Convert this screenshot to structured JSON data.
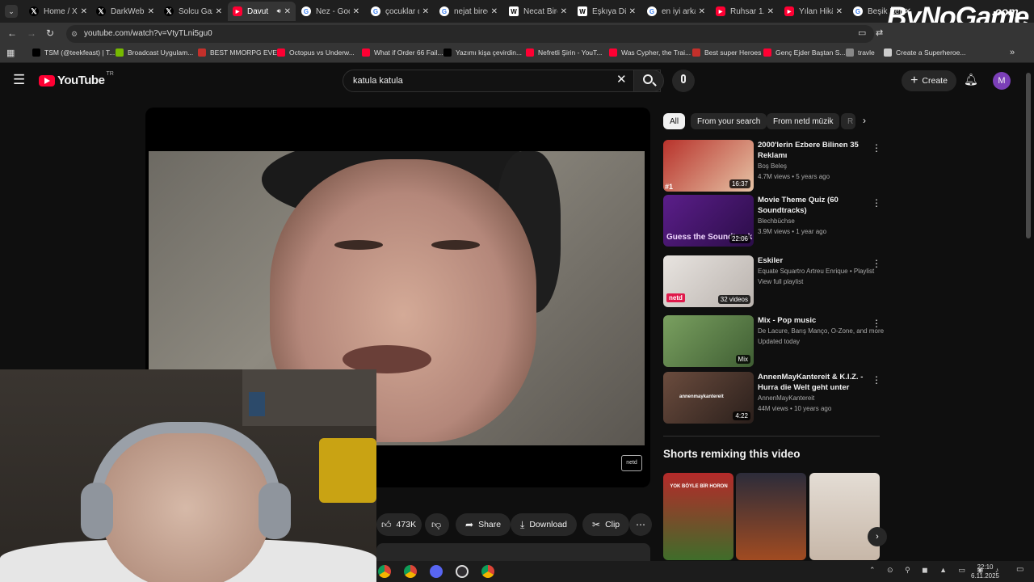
{
  "browser": {
    "tabs": [
      {
        "label": "Home / X",
        "icon": "x-icon",
        "color": "#000000"
      },
      {
        "label": "DarkWeb",
        "icon": "x-icon",
        "color": "#000000"
      },
      {
        "label": "Solcu Gaz",
        "icon": "x-icon",
        "color": "#000000"
      },
      {
        "label": "Davut",
        "icon": "youtube-icon",
        "color": "#ff0033",
        "active": true
      },
      {
        "label": "Nez - Goo",
        "icon": "google-icon",
        "color": "#4285f4"
      },
      {
        "label": "çocuklar d",
        "icon": "google-icon",
        "color": "#4285f4"
      },
      {
        "label": "nejat birec",
        "icon": "google-icon",
        "color": "#4285f4"
      },
      {
        "label": "Necat Bire",
        "icon": "wikipedia-icon",
        "color": "#ffffff"
      },
      {
        "label": "Eşkıya Dün",
        "icon": "wikipedia-icon",
        "color": "#ffffff"
      },
      {
        "label": "en iyi arka",
        "icon": "google-icon",
        "color": "#4285f4"
      },
      {
        "label": "Ruhsar 1.",
        "icon": "youtube-icon",
        "color": "#ff0033"
      },
      {
        "label": "Yılan Hikâ",
        "icon": "youtube-icon",
        "color": "#ff0033"
      },
      {
        "label": "Beşik Kert",
        "icon": "google-icon",
        "color": "#4285f4"
      }
    ],
    "url": "youtube.com/watch?v=VtyTLni5gu0",
    "bookmarks": [
      {
        "label": "TSM (@teekfeast) | T...",
        "color": "#000000"
      },
      {
        "label": "Broadcast Uygulam...",
        "color": "#76b900"
      },
      {
        "label": "BEST MMORPG EVER",
        "color": "#c4302b"
      },
      {
        "label": "Octopus vs Underw...",
        "color": "#ff0033"
      },
      {
        "label": "What if Order 66 Fail...",
        "color": "#ff0033"
      },
      {
        "label": "Yazımı kişa çevirdin...",
        "color": "#000000"
      },
      {
        "label": "Nefretli Şirin - YouT...",
        "color": "#ff0033"
      },
      {
        "label": "Was Cypher, the Trai...",
        "color": "#ff0033"
      },
      {
        "label": "Best super Heroes",
        "color": "#c4302b"
      },
      {
        "label": "Genç Ejder Baştan S...",
        "color": "#ff0033"
      },
      {
        "label": "travle",
        "color": "#888888"
      },
      {
        "label": "Create a Superheroe...",
        "color": "#cccccc"
      }
    ]
  },
  "watermark": {
    "text": "ByNoGame",
    "suffix": ".com"
  },
  "youtube": {
    "logo_text": "YouTube",
    "logo_sup": "TR",
    "search_value": "katula katula",
    "create_label": "Create",
    "avatar_letter": "M"
  },
  "video": {
    "channel_logo": "netd",
    "actions": {
      "likes": "473K",
      "share": "Share",
      "download": "Download",
      "clip": "Clip"
    }
  },
  "sidebar": {
    "chips": [
      "All",
      "From your search",
      "From netd müzik",
      "R"
    ],
    "recommendations": [
      {
        "title": "2000'lerin Ezbere Bilinen 35 Reklamı",
        "channel": "Boş Beleş",
        "meta": "4.7M views • 5 years ago",
        "badge": "16:37",
        "rank": "#1",
        "colors": [
          "#b8322b",
          "#e6c3a5"
        ]
      },
      {
        "title": "Movie Theme Quiz (60 Soundtracks)",
        "channel": "Blechbüchse",
        "meta": "3.9M views • 1 year ago",
        "badge": "22:06",
        "overlay": "Guess the Soundtrack",
        "colors": [
          "#5b1e8a",
          "#2b0d48"
        ]
      },
      {
        "title": "Eskiler",
        "channel": "Equate Squartro Artreu Enrique • Playlist",
        "meta": "View full playlist",
        "badge": "32 videos",
        "overlay": "netd",
        "colors": [
          "#e8e4e0",
          "#b9b2ad"
        ]
      },
      {
        "title": "Mix - Pop music",
        "channel": "De Lacure, Barış Manço, O-Zone, and more",
        "meta": "Updated today",
        "badge": "Mix",
        "colors": [
          "#7aa060",
          "#3f5e33"
        ]
      },
      {
        "title": "AnnenMayKantereit & K.I.Z. - Hurra die Welt geht unter",
        "channel": "AnnenMayKantereit",
        "meta": "44M views • 10 years ago",
        "badge": "4:22",
        "overlay": "annenmaykantereit",
        "colors": [
          "#6b4c3e",
          "#2a1f1b"
        ]
      }
    ],
    "shorts_title": "Shorts remixing this video",
    "shorts": [
      {
        "overlay": "YOK BÖYLE BİR HORON",
        "colors": [
          "#b52a2a",
          "#3f6d2a"
        ]
      },
      {
        "overlay": "",
        "colors": [
          "#2c2c3a",
          "#a14b21"
        ]
      },
      {
        "overlay": "",
        "colors": [
          "#e4ddd5",
          "#c7b7a8"
        ]
      }
    ]
  },
  "taskbar": {
    "time": "22:10",
    "date": "6.11.2025"
  }
}
